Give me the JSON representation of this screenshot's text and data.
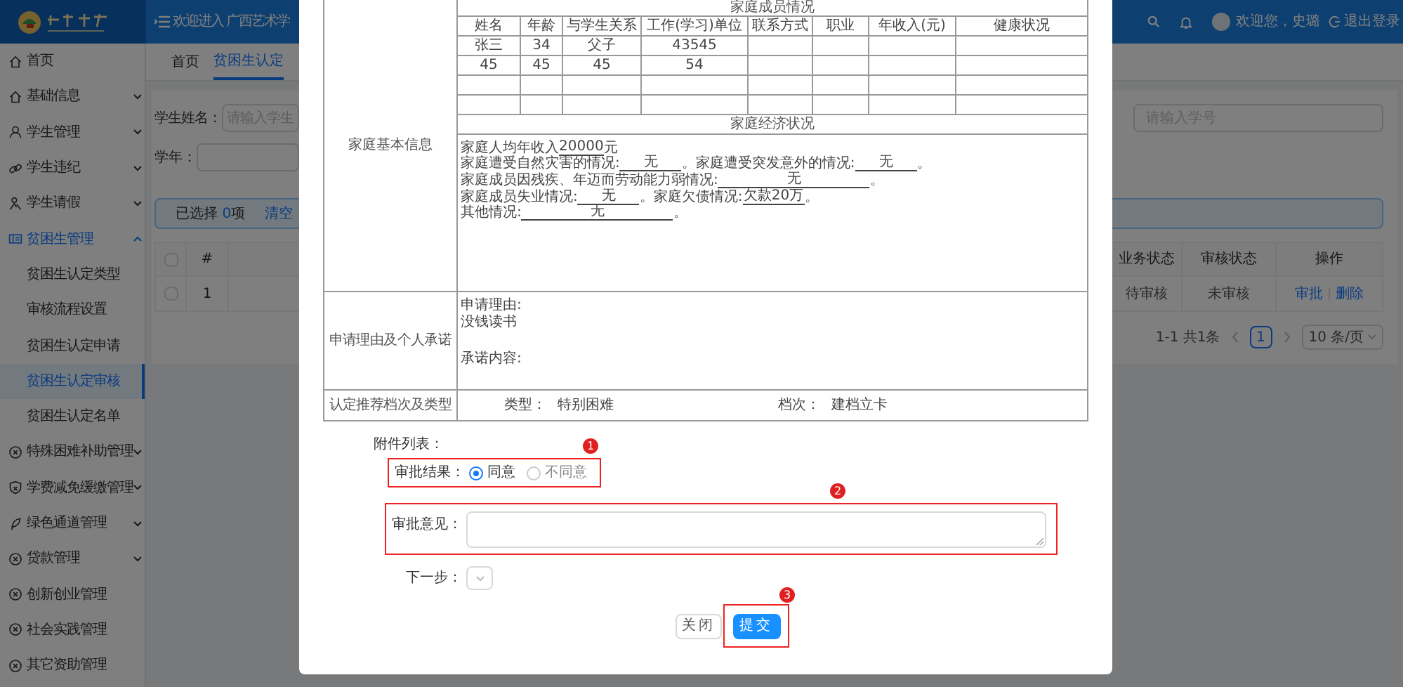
{
  "header": {
    "welcome": "欢迎进入 广西艺术学",
    "user": "欢迎您，史璐",
    "logout": "退出登录"
  },
  "sidebar": {
    "items": [
      {
        "label": "首页",
        "kind": "link",
        "expanded": false
      },
      {
        "label": "基础信息",
        "kind": "group",
        "expanded": false
      },
      {
        "label": "学生管理",
        "kind": "group",
        "expanded": false
      },
      {
        "label": "学生违纪",
        "kind": "group",
        "expanded": false
      },
      {
        "label": "学生请假",
        "kind": "group",
        "expanded": false
      },
      {
        "label": "贫困生管理",
        "kind": "group",
        "expanded": true,
        "children": [
          {
            "label": "贫困生认定类型",
            "selected": false
          },
          {
            "label": "审核流程设置",
            "selected": false
          },
          {
            "label": "贫困生认定申请",
            "selected": false
          },
          {
            "label": "贫困生认定审核",
            "selected": true
          },
          {
            "label": "贫困生认定名单",
            "selected": false
          }
        ]
      },
      {
        "label": "特殊困难补助管理",
        "kind": "group",
        "expanded": false
      },
      {
        "label": "学费减免缓缴管理",
        "kind": "group",
        "expanded": false
      },
      {
        "label": "绿色通道管理",
        "kind": "group",
        "expanded": false
      },
      {
        "label": "贷款管理",
        "kind": "group",
        "expanded": false
      },
      {
        "label": "创新创业管理",
        "kind": "link",
        "expanded": false
      },
      {
        "label": "社会实践管理",
        "kind": "link",
        "expanded": false
      },
      {
        "label": "其它资助管理",
        "kind": "link",
        "expanded": false
      }
    ]
  },
  "tabs": [
    {
      "label": "首页",
      "selected": false
    },
    {
      "label": "贫困生认定",
      "selected": true
    }
  ],
  "filters": {
    "student_name": {
      "label": "学生姓名：",
      "placeholder": "请输入学生"
    },
    "year": {
      "label": "学年："
    },
    "student_id": {
      "placeholder": "请输入学号"
    }
  },
  "selection": {
    "prefix": "已选择",
    "count": "0",
    "suffix": "项",
    "clear": "清空"
  },
  "table": {
    "all_checked": false,
    "number_column": "#",
    "columns_right": [
      "业务状态",
      "审核状态",
      "操作"
    ],
    "rows": [
      {
        "checked": false,
        "number": "1",
        "business_status": "待审核",
        "review_status": "未审核",
        "actions": [
          "审批",
          "删除"
        ]
      }
    ]
  },
  "pagination": {
    "range": "1-1 共1条",
    "pages": [
      {
        "label": "1",
        "selected": true
      }
    ],
    "page_size": "10 条/页"
  },
  "modal": {
    "family": {
      "label": "家庭基本信息",
      "members_title": "家庭成员情况",
      "columns": [
        "姓名",
        "年龄",
        "与学生关系",
        "工作(学习)单位",
        "联系方式",
        "职业",
        "年收入(元)",
        "健康状况"
      ],
      "rows": [
        [
          "张三",
          "34",
          "父子",
          "43545"
        ],
        [
          "45",
          "45",
          "45",
          "54"
        ]
      ],
      "economy_title": "家庭经济状况",
      "economy_lines": [
        [
          {
            "text": "家庭人均年收入",
            "kind": "text"
          },
          {
            "text": "20000",
            "kind": "underlined"
          },
          {
            "text": "元",
            "kind": "text"
          }
        ],
        [
          {
            "text": "家庭遭受自然灾害的情况:",
            "kind": "text"
          },
          {
            "text": "无",
            "kind": "fill"
          },
          {
            "text": "。家庭遭受突发意外的情况:",
            "kind": "text"
          },
          {
            "text": "无",
            "kind": "fill"
          },
          {
            "text": "。",
            "kind": "text"
          }
        ],
        [
          {
            "text": "家庭成员因残疾、年迈而劳动能力弱情况:",
            "kind": "text"
          },
          {
            "text": "无",
            "kind": "wide_fill"
          },
          {
            "text": "。",
            "kind": "text"
          }
        ],
        [
          {
            "text": "家庭成员失业情况:",
            "kind": "text"
          },
          {
            "text": "无",
            "kind": "fill"
          },
          {
            "text": "。家庭欠债情况:",
            "kind": "text"
          },
          {
            "text": "欠款20万",
            "kind": "fill"
          },
          {
            "text": "。",
            "kind": "text"
          }
        ],
        [
          {
            "text": "其他情况:",
            "kind": "text"
          },
          {
            "text": "无",
            "kind": "wide_fill"
          },
          {
            "text": "。",
            "kind": "text"
          }
        ]
      ]
    },
    "reason": {
      "label": "申请理由及个人承诺",
      "reason_label": "申请理由:",
      "reason": "没钱读书",
      "promise_label": "承诺内容:"
    },
    "recommendation": {
      "label": "认定推荐档次及类型",
      "type_label": "类型：",
      "type": "特别困难",
      "grade_label": "档次：",
      "grade": "建档立卡"
    },
    "attachments_label": "附件列表：",
    "result": {
      "label": "审批结果：",
      "marker": "1",
      "options": [
        {
          "label": "同意",
          "selected": true
        },
        {
          "label": "不同意",
          "selected": false
        }
      ]
    },
    "opinion": {
      "label": "审批意见：",
      "marker": "2"
    },
    "next_step": {
      "label": "下一步："
    },
    "buttons": [
      {
        "label": "关闭",
        "kind": "default"
      },
      {
        "label": "提交",
        "kind": "primary",
        "marker": "3"
      }
    ]
  }
}
